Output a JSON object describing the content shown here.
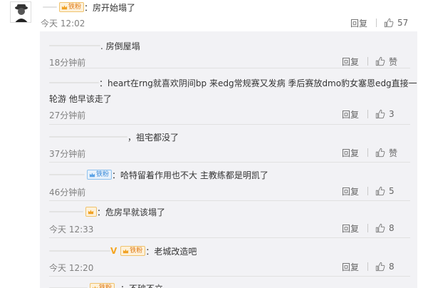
{
  "main_comment": {
    "badge_text": "铁粉",
    "text": "：房开始塌了",
    "time": "今天 12:02",
    "reply_label": "回复",
    "like_count": "57"
  },
  "replies": [
    {
      "text": ". 房倒屋塌",
      "time": "18分钟前",
      "reply_label": "回复",
      "like": "赞"
    },
    {
      "text": "：heart在rng就喜欢阴间bp 来edg常规赛又发病 季后赛放dmo豹女塞恩edg直接一",
      "text2": "轮游 他早该走了",
      "time": "27分钟前",
      "reply_label": "回复",
      "like": "3"
    },
    {
      "text": "，祖宅都没了",
      "time": "37分钟前",
      "reply_label": "回复",
      "like": "赞"
    },
    {
      "badge_text": "铁粉",
      "text": "：哈特留着作用也不大 主教练都是明凯了",
      "time": "46分钟前",
      "reply_label": "回复",
      "like": "5"
    },
    {
      "text": "：危房早就该塌了",
      "time": "今天 12:33",
      "reply_label": "回复",
      "like": "8"
    },
    {
      "badge_text": "铁粉",
      "text": "：老城改造吧",
      "time": "今天 12:20",
      "reply_label": "回复",
      "like": "8"
    },
    {
      "badge_text": "铁粉",
      "text": "：不破不立"
    }
  ],
  "icons": {
    "thumb": "thumbs-up-icon",
    "crown": "crown-icon",
    "verified": "verified-v-icon"
  },
  "colors": {
    "reply_bg": "#f2f2f5",
    "badge_orange": "#e07a17",
    "badge_blue": "#3a8ad8",
    "muted_text": "#808080"
  }
}
